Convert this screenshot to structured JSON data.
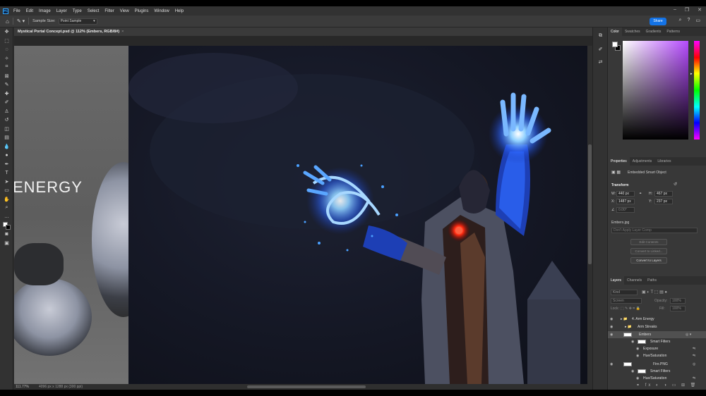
{
  "menu": {
    "items": [
      "File",
      "Edit",
      "Image",
      "Layer",
      "Type",
      "Select",
      "Filter",
      "View",
      "Plugins",
      "Window",
      "Help"
    ],
    "logo": "Ps"
  },
  "options": {
    "sample_size_label": "Sample Size:",
    "sample_size_value": "Point Sample",
    "share_label": "Share"
  },
  "document": {
    "tab_title": "Mystical Portal Concept.psd @ 112% (Embers, RGB/8#)",
    "zoom": "111.77%",
    "dimensions": "4096 px x 1288 px (300 ppi)",
    "canvas_text": "ENERGY"
  },
  "color_panel": {
    "tabs": [
      "Color",
      "Swatches",
      "Gradients",
      "Patterns"
    ]
  },
  "properties_panel": {
    "tabs": [
      "Properties",
      "Adjustments",
      "Libraries"
    ],
    "type_label": "Embedded Smart Object",
    "transform_label": "Transform",
    "w_label": "W:",
    "w_value": "440 px",
    "h_label": "H:",
    "h_value": "467 px",
    "x_label": "X:",
    "x_value": "1487 px",
    "y_label": "Y:",
    "y_value": "237 px",
    "angle_value": "0.00°",
    "source_file": "Embers.jpg",
    "comp_placeholder": "Don't Apply Layer Comp",
    "btn_edit": "Edit Contents",
    "btn_linked": "Convert to Linked...",
    "btn_layers": "Convert to Layers"
  },
  "layers_panel": {
    "tabs": [
      "Layers",
      "Channels",
      "Paths"
    ],
    "kind_placeholder": "Kind",
    "blend_mode": "Screen",
    "opacity_label": "Opacity:",
    "opacity_value": "100%",
    "lock_label": "Lock:",
    "fill_label": "Fill:",
    "fill_value": "100%",
    "layers": [
      {
        "name": "4. Arm Energy"
      },
      {
        "name": "Arm Streaks"
      },
      {
        "name": "Embers"
      },
      {
        "name": "Smart Filters"
      },
      {
        "name": "Exposure"
      },
      {
        "name": "Hue/Saturation"
      },
      {
        "name": "Fire.PNG"
      },
      {
        "name": "Smart Filters"
      },
      {
        "name": "Hue/Saturation"
      }
    ]
  }
}
